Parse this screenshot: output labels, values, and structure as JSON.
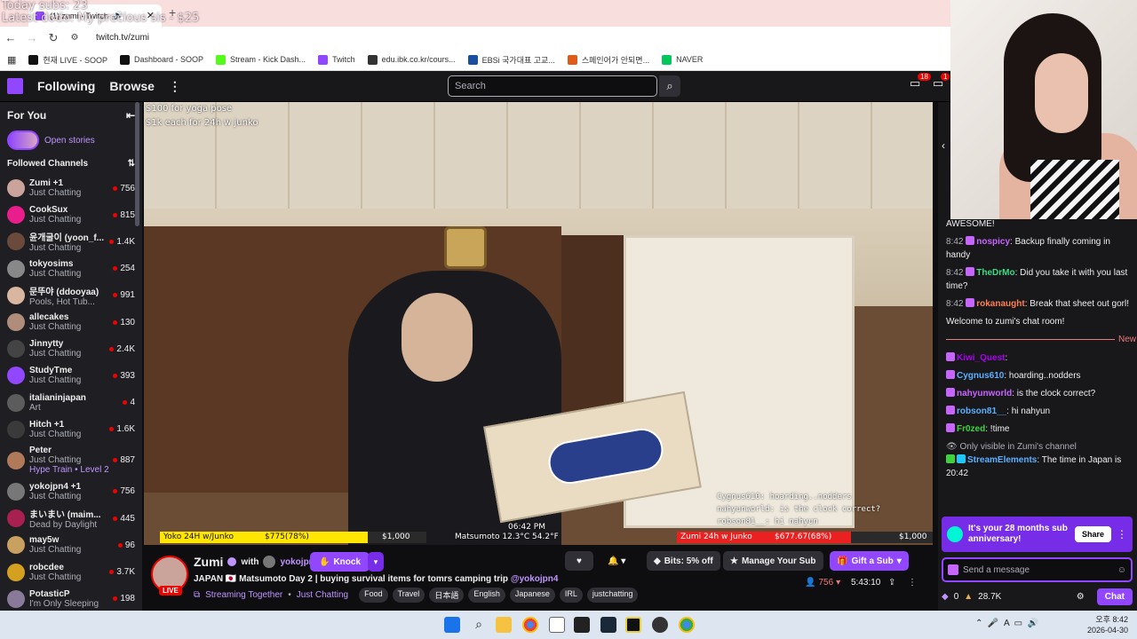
{
  "overlay": {
    "line1": "Today subs: 23",
    "line2": "Latest dodo: My precious sis - $25"
  },
  "browser": {
    "tab_title": "(1) zumi - Twitch",
    "url": "twitch.tv/zumi",
    "bookmarks": [
      {
        "label": "현재 LIVE - SOOP",
        "color": "#111"
      },
      {
        "label": "Dashboard - SOOP",
        "color": "#111"
      },
      {
        "label": "Stream - Kick Dash...",
        "color": "#53fc18"
      },
      {
        "label": "Twitch",
        "color": "#9146ff"
      },
      {
        "label": "edu.ibk.co.kr/cours...",
        "color": "#333"
      },
      {
        "label": "EBSi 국가대표 고교...",
        "color": "#1a4fa0"
      },
      {
        "label": "스페인어가 안되면...",
        "color": "#e05a1a"
      },
      {
        "label": "NAVER",
        "color": "#03c75a"
      }
    ]
  },
  "twitch": {
    "nav_following": "Following",
    "nav_browse": "Browse",
    "search_placeholder": "Search",
    "inbox_count": "18",
    "alerts_count": "1"
  },
  "sidebar": {
    "for_you": "For You",
    "open_stories": "Open stories",
    "followed": "Followed Channels",
    "channels": [
      {
        "name": "Zumi +1",
        "category": "Just Chatting",
        "viewers": "756",
        "color": "#caa49a"
      },
      {
        "name": "CookSux",
        "category": "Just Chatting",
        "viewers": "815",
        "color": "#e91e8c"
      },
      {
        "name": "윤개굴이 (yoon_f...",
        "category": "Just Chatting",
        "viewers": "1.4K",
        "color": "#6a4a3a"
      },
      {
        "name": "tokyosims",
        "category": "Just Chatting",
        "viewers": "254",
        "color": "#888"
      },
      {
        "name": "문뚜야 (ddooyaa)",
        "category": "Pools, Hot Tub...",
        "viewers": "991",
        "color": "#d9b6a0"
      },
      {
        "name": "allecakes",
        "category": "Just Chatting",
        "viewers": "130",
        "color": "#b08d7a"
      },
      {
        "name": "Jinnytty",
        "category": "Just Chatting",
        "viewers": "2.4K",
        "color": "#444"
      },
      {
        "name": "StudyTme",
        "category": "Just Chatting",
        "viewers": "393",
        "color": "#9146ff"
      },
      {
        "name": "italianinjapan",
        "category": "Art",
        "viewers": "4",
        "color": "#5c5c5c"
      },
      {
        "name": "Hitch +1",
        "category": "Just Chatting",
        "viewers": "1.6K",
        "color": "#3a3a3a"
      },
      {
        "name": "Peter",
        "category": "Just Chatting",
        "viewers": "887",
        "color": "#b07a5a"
      },
      {
        "name": "yokojpn4 +1",
        "category": "Just Chatting",
        "viewers": "756",
        "color": "#777"
      },
      {
        "name": "まいまい (maim...",
        "category": "Dead by Daylight",
        "viewers": "445",
        "color": "#a82050"
      },
      {
        "name": "may5w",
        "category": "Just Chatting",
        "viewers": "96",
        "color": "#c8a060"
      },
      {
        "name": "robcdee",
        "category": "Just Chatting",
        "viewers": "3.7K",
        "color": "#d4a020"
      },
      {
        "name": "PotasticP",
        "category": "I'm Only Sleeping",
        "viewers": "198",
        "color": "#8a7a9a"
      }
    ],
    "hype_train": "Hype Train • Level 2"
  },
  "video": {
    "overlay_line1": "$100 for yoga pose",
    "overlay_line2": "$1k each for 24h w junko",
    "bar_left": "Yoko 24H w/Junko",
    "bar_left_amt": "$775(78%)",
    "bar_left_goal": "$1,000",
    "bar_left_progress": 0.78,
    "bar_right": "Zumi 24h w Junko",
    "bar_right_amt": "$677.67(68%)",
    "bar_right_goal": "$1,000",
    "bar_right_progress": 0.68,
    "clock": "06:42 PM",
    "weather": "Matsumoto 12.3°C  54.2°F",
    "chat_lines": [
      "Cygnus610: hoarding..nodders",
      "nahyunworld: is the clock correct?",
      "robson81__: hi nahyun"
    ]
  },
  "stream": {
    "streamer": "Zumi",
    "with": "with",
    "guest": "yokojpn4",
    "knock": "Knock",
    "title": "JAPAN 🇯🇵 Matsumoto Day 2 | buying survival items for tomrs camping trip",
    "title_mention": "@yokojpn4",
    "live": "LIVE",
    "together": "Streaming Together",
    "category": "Just Chatting",
    "tags": [
      "Food",
      "Travel",
      "日本語",
      "English",
      "Japanese",
      "IRL",
      "justchatting"
    ],
    "bits": "Bits: 5% off",
    "manage": "Manage Your Sub",
    "gift": "Gift a Sub",
    "viewers": "756",
    "uptime": "5:43:10"
  },
  "chat": {
    "awesome": "AWESOME!",
    "messages": [
      {
        "time": "8:42",
        "user": "nospicy",
        "cls": "u1",
        "text": ": Backup finally coming in handy"
      },
      {
        "time": "8:42",
        "user": "TheDrMo",
        "cls": "u2",
        "text": ": Did you take it with you last time?"
      },
      {
        "time": "8:42",
        "user": "rokanaught",
        "cls": "u3",
        "text": ": Break that sheet out gorl!"
      }
    ],
    "welcome": "Welcome to zumi's chat room!",
    "new_label": "New",
    "messages2": [
      {
        "user": "Kiwi_Quest",
        "cls": "u4",
        "text": ":"
      },
      {
        "user": "Cygnus610",
        "cls": "u5",
        "text": ": hoarding..nodders"
      },
      {
        "user": "nahyunworld",
        "cls": "u1",
        "text": ": is the clock correct?"
      },
      {
        "user": "robson81__",
        "cls": "u5",
        "text": ": hi nahyun"
      },
      {
        "user": "Fr0zed",
        "cls": "u6",
        "text": ": !time"
      }
    ],
    "only_visible": "Only visible in Zumi's channel",
    "se_user": "StreamElements",
    "se_text": ": The time in Japan is 20:42",
    "sub_text": "It's your 28 months sub anniversary!",
    "share": "Share",
    "placeholder": "Send a message",
    "points": "0",
    "bits_balance": "28.7K",
    "chat_btn": "Chat"
  },
  "taskbar": {
    "time": "오후 8:42",
    "date": "2026-04-30"
  }
}
